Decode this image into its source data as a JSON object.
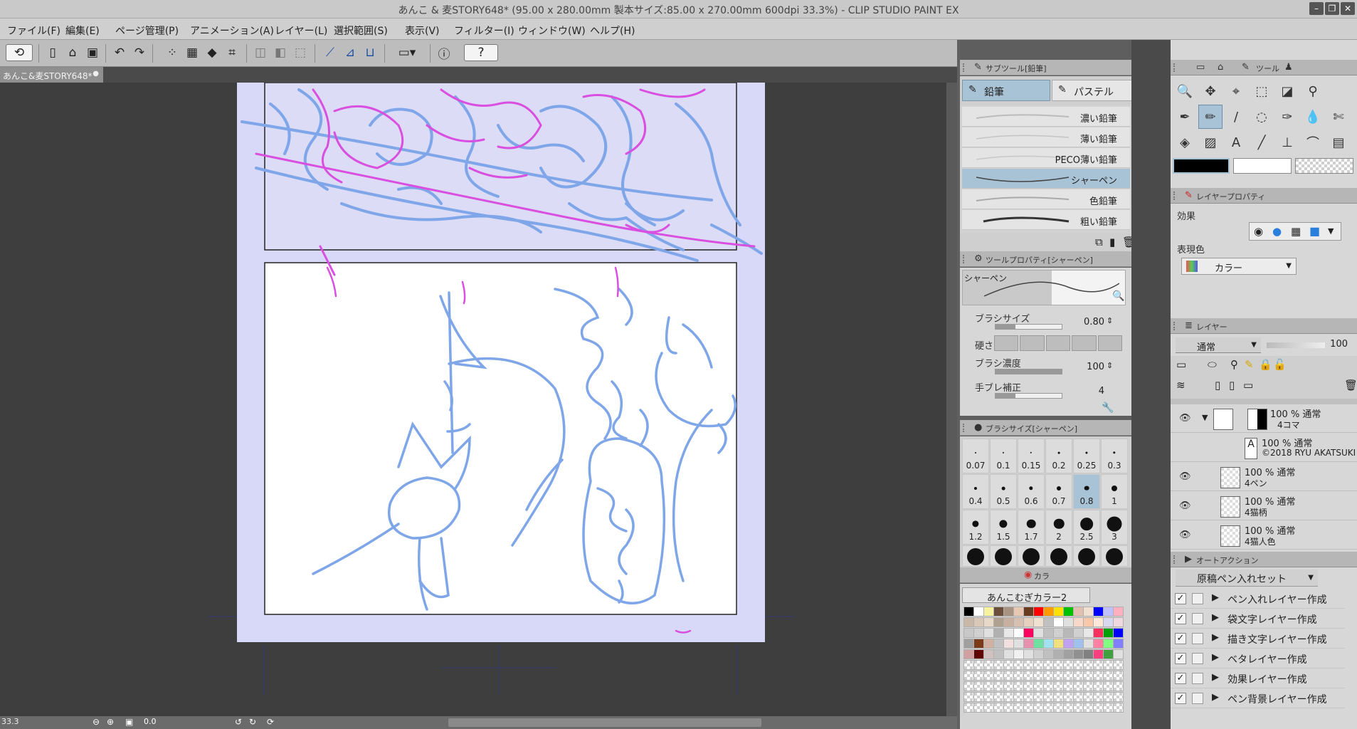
{
  "window": {
    "title": "あんこ & 麦STORY648* (95.00 x 280.00mm 製本サイズ:85.00 x 270.00mm 600dpi 33.3%) - CLIP STUDIO PAINT EX"
  },
  "menu": [
    "ファイル(F)",
    "編集(E)",
    "ページ管理(P)",
    "アニメーション(A)",
    "レイヤー(L)",
    "選択範囲(S)",
    "表示(V)",
    "フィルター(I)",
    "ウィンドウ(W)",
    "ヘルプ(H)"
  ],
  "document_tab": {
    "label": "あんこ&麦STORY648*"
  },
  "status": {
    "zoom": "33.3",
    "rotation": "0.0"
  },
  "sub_tool_panel": {
    "header": "サブツール[鉛筆]",
    "tabs": [
      "鉛筆",
      "パステル"
    ],
    "brushes": [
      "濃い鉛筆",
      "薄い鉛筆",
      "PECO薄い鉛筆",
      "シャーペン",
      "色鉛筆",
      "粗い鉛筆"
    ],
    "selected_brush": "シャーペン"
  },
  "tool_property": {
    "header": "ツールプロパティ[シャーペン]",
    "preview_label": "シャーペン",
    "brush_size_label": "ブラシサイズ",
    "brush_size_value": "0.80",
    "brush_size_fill": 0.3,
    "hardness_label": "硬さ",
    "density_label": "ブラシ濃度",
    "density_value": "100",
    "density_fill": 1.0,
    "stabilization_label": "手ブレ補正",
    "stabilization_value": "4",
    "stabilization_fill": 0.3
  },
  "brush_size_panel": {
    "header": "ブラシサイズ[シャーペン]",
    "sizes": [
      "0.07",
      "0.1",
      "0.15",
      "0.2",
      "0.25",
      "0.3",
      "0.4",
      "0.5",
      "0.6",
      "0.7",
      "0.8",
      "1",
      "1.2",
      "1.5",
      "1.7",
      "2",
      "2.5",
      "3"
    ],
    "selected": "0.8"
  },
  "color_set": {
    "tab_label": "カラ",
    "set_name": "あんこむぎカラー2"
  },
  "tool_panel": {
    "header": "ツール"
  },
  "layer_property": {
    "header": "レイヤープロパティ",
    "effect_label": "効果",
    "expression_label": "表現色",
    "expression_value": "カラー"
  },
  "layer_panel": {
    "header": "レイヤー",
    "blend_mode": "通常",
    "opacity": "100",
    "layers": [
      {
        "line1": "100 % 通常",
        "line2": "4コマ"
      },
      {
        "line1": "100 % 通常",
        "line2": "©2018 RYU AKATSUKI"
      },
      {
        "line1": "100 % 通常",
        "line2": "4ペン"
      },
      {
        "line1": "100 % 通常",
        "line2": "4猫柄"
      },
      {
        "line1": "100 % 通常",
        "line2": "4猫人色"
      }
    ]
  },
  "auto_action": {
    "header": "オートアクション",
    "set_name": "原稿ペン入れセット",
    "actions": [
      "ペン入れレイヤー作成",
      "袋文字レイヤー作成",
      "描き文字レイヤー作成",
      "ベタレイヤー作成",
      "効果レイヤー作成",
      "ペン背景レイヤー作成"
    ]
  },
  "colors": {
    "accent_selected": "#a9c3d6",
    "sketch_blue": "#7fa6e8",
    "sketch_magenta": "#d94fe0",
    "page_lavender": "#d8d8f8"
  }
}
